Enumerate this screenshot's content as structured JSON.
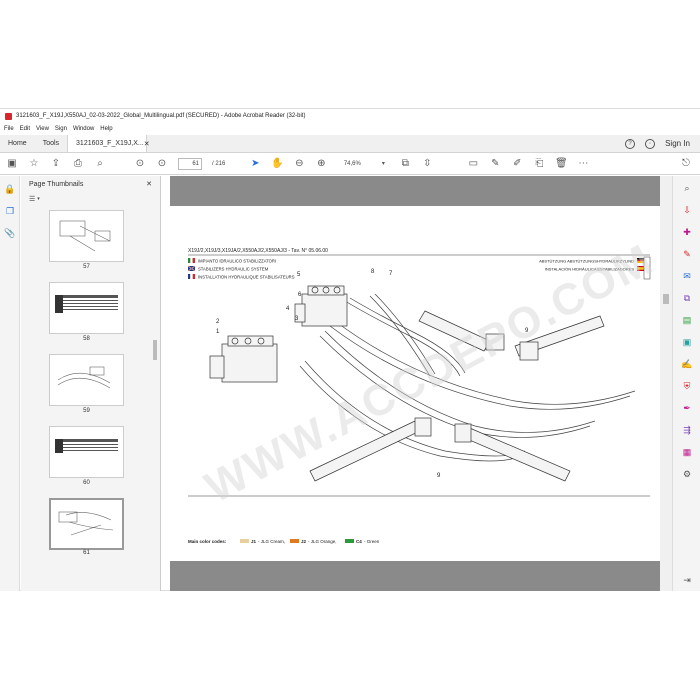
{
  "window": {
    "title": "3121603_F_X19J,X550AJ_02-03-2022_Global_Multilingual.pdf (SECURED) - Adobe Acrobat Reader (32-bit)"
  },
  "menu": [
    "File",
    "Edit",
    "View",
    "Sign",
    "Window",
    "Help"
  ],
  "tabs": {
    "home": "Home",
    "tools": "Tools",
    "document": "3121603_F_X19J,X...",
    "sign_in": "Sign In"
  },
  "toolbar": {
    "page_current": "61",
    "page_total": "/ 216",
    "zoom": "74,6%"
  },
  "thumbnails": {
    "title": "Page Thumbnails",
    "pages": [
      "57",
      "58",
      "59",
      "60",
      "61"
    ]
  },
  "document": {
    "header": "X19J/2,X19J/3,X19JA/2,X550AJ/2,X550AJ/3 - Tav. N° 05.06.00",
    "left_titles": [
      "IMPIANTO IDRAULICO STABILIZZATORI",
      "STABILIZERS HYDRAULIC SYSTEM",
      "INSTALLATION HYDRAULIQUE STABILISATEURS"
    ],
    "right_titles": [
      "ABSTÜTZUNG ABSTÜTZUNGSHYDRAULIKZYLIND",
      "INSTALACIÓN HIDRÁULICA ESTABILIZADORES"
    ],
    "callouts": [
      "1",
      "2",
      "3",
      "4",
      "5",
      "6",
      "7",
      "8",
      "9",
      "9"
    ],
    "footer_label": "Main color codes:",
    "color_codes": [
      {
        "code": "J1",
        "name": "- JLG Cream,",
        "color": "#e8cfa0"
      },
      {
        "code": "J2",
        "name": "- JLG Orange,",
        "color": "#e07a1f"
      },
      {
        "code": "C4",
        "name": "- Green",
        "color": "#2a9a3a"
      }
    ]
  },
  "watermark": "WWW.ACCDEPO.COM",
  "colors": {
    "accent_red": "#d8262c",
    "viewer_bg": "#8a8a8a"
  }
}
